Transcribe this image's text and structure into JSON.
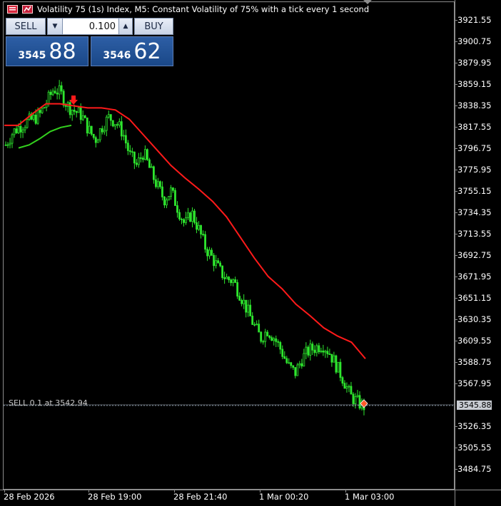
{
  "window": {
    "title": "Volatility 75 (1s) Index, M5:  Constant Volatility of 75% with a tick every 1 second"
  },
  "trade_panel": {
    "sell_label": "SELL",
    "buy_label": "BUY",
    "lot_value": "0.100",
    "sell_price_small": "3545",
    "sell_price_big": "88",
    "buy_price_small": "3546",
    "buy_price_big": "62"
  },
  "icons": {
    "lot_down": "triangle-down-icon",
    "lot_up": "triangle-up-icon",
    "symbol": "chart-window-icon"
  },
  "chart_data": {
    "type": "candlestick",
    "y_ticks": [
      "3921.55",
      "3900.75",
      "3879.95",
      "3859.15",
      "3838.35",
      "3817.55",
      "3796.75",
      "3775.95",
      "3755.15",
      "3734.35",
      "3713.55",
      "3692.75",
      "3671.95",
      "3651.15",
      "3630.35",
      "3609.55",
      "3588.75",
      "3567.95",
      "3545.88",
      "3526.35",
      "3505.55",
      "3484.75"
    ],
    "x_ticks": [
      "28 Feb 2026",
      "28 Feb 19:00",
      "28 Feb 21:40",
      "1 Mar 00:20",
      "1 Mar 03:00"
    ],
    "ylim": [
      3470,
      3935
    ],
    "current_price": "3545.88",
    "order_line_label": "SELL 0.1 at 3542.94",
    "close_path": [
      3800,
      3812,
      3818,
      3822,
      3825,
      3830,
      3842,
      3855,
      3850,
      3838,
      3833,
      3829,
      3815,
      3805,
      3818,
      3827,
      3822,
      3812,
      3790,
      3780,
      3793,
      3775,
      3760,
      3747,
      3755,
      3738,
      3722,
      3734,
      3718,
      3700,
      3690,
      3678,
      3670,
      3668,
      3655,
      3640,
      3625,
      3612,
      3620,
      3612,
      3600,
      3585,
      3578,
      3592,
      3600,
      3603,
      3606,
      3598,
      3585,
      3572,
      3556,
      3550,
      3545.88
    ],
    "series": [
      {
        "name": "",
        "color": "#ff1a1a",
        "values": [
          3819,
          3819,
          3830,
          3840,
          3840,
          3838,
          3836,
          3836,
          3834,
          3825,
          3810,
          3795,
          3780,
          3768,
          3757,
          3745,
          3730,
          3710,
          3690,
          3672,
          3660,
          3645,
          3634,
          3622,
          3614,
          3608,
          3592
        ]
      },
      {
        "name": "",
        "color": "#33d11e",
        "values": [
          3797,
          3800,
          3806,
          3813,
          3817,
          3819
        ]
      }
    ],
    "colors": {
      "candle": "#2ee62e",
      "background": "#000000",
      "grid": "#8c8c8c"
    }
  }
}
